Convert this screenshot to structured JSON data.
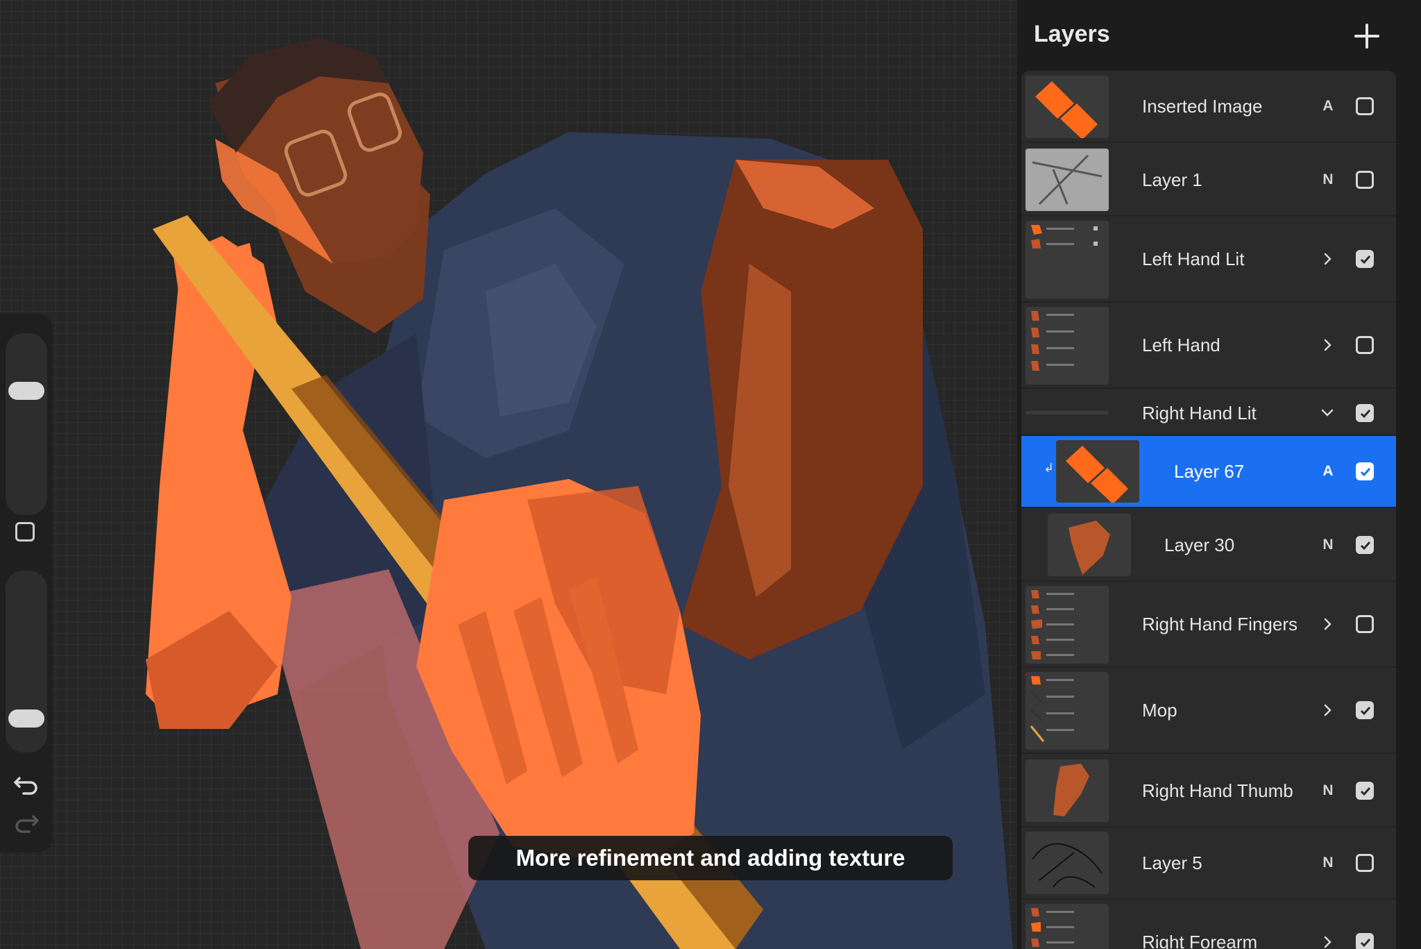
{
  "caption": "More refinement and adding texture",
  "panel": {
    "title": "Layers",
    "add_icon": "plus-icon"
  },
  "colors": {
    "accent": "#1a70f0",
    "panel_bg": "#1c1c1c",
    "row_bg": "#2b2b2b",
    "canvas_bg": "#262626",
    "skin_orange": "#ff7a3c"
  },
  "layers": [
    {
      "name": "Inserted Image",
      "mode": "A",
      "checked": false,
      "kind": "layer"
    },
    {
      "name": "Layer 1",
      "mode": "N",
      "checked": false,
      "kind": "layer"
    },
    {
      "name": "Left Hand Lit",
      "mode": "",
      "checked": true,
      "kind": "group-collapsed"
    },
    {
      "name": "Left Hand",
      "mode": "",
      "checked": false,
      "kind": "group-collapsed"
    },
    {
      "name": "Right Hand Lit",
      "mode": "",
      "checked": true,
      "kind": "group-expanded"
    },
    {
      "name": "Layer 67",
      "mode": "A",
      "checked": true,
      "kind": "layer",
      "selected": true
    },
    {
      "name": "Layer 30",
      "mode": "N",
      "checked": true,
      "kind": "layer"
    },
    {
      "name": "Right Hand Fingers",
      "mode": "",
      "checked": false,
      "kind": "group-collapsed"
    },
    {
      "name": "Mop",
      "mode": "",
      "checked": true,
      "kind": "group-collapsed"
    },
    {
      "name": "Right Hand Thumb",
      "mode": "N",
      "checked": true,
      "kind": "layer"
    },
    {
      "name": "Layer 5",
      "mode": "N",
      "checked": false,
      "kind": "layer"
    },
    {
      "name": "Right Forearm",
      "mode": "",
      "checked": true,
      "kind": "group-collapsed"
    }
  ],
  "toolbar": {
    "undo_icon": "undo-icon",
    "redo_icon": "redo-icon",
    "modify_icon": "square-icon"
  }
}
